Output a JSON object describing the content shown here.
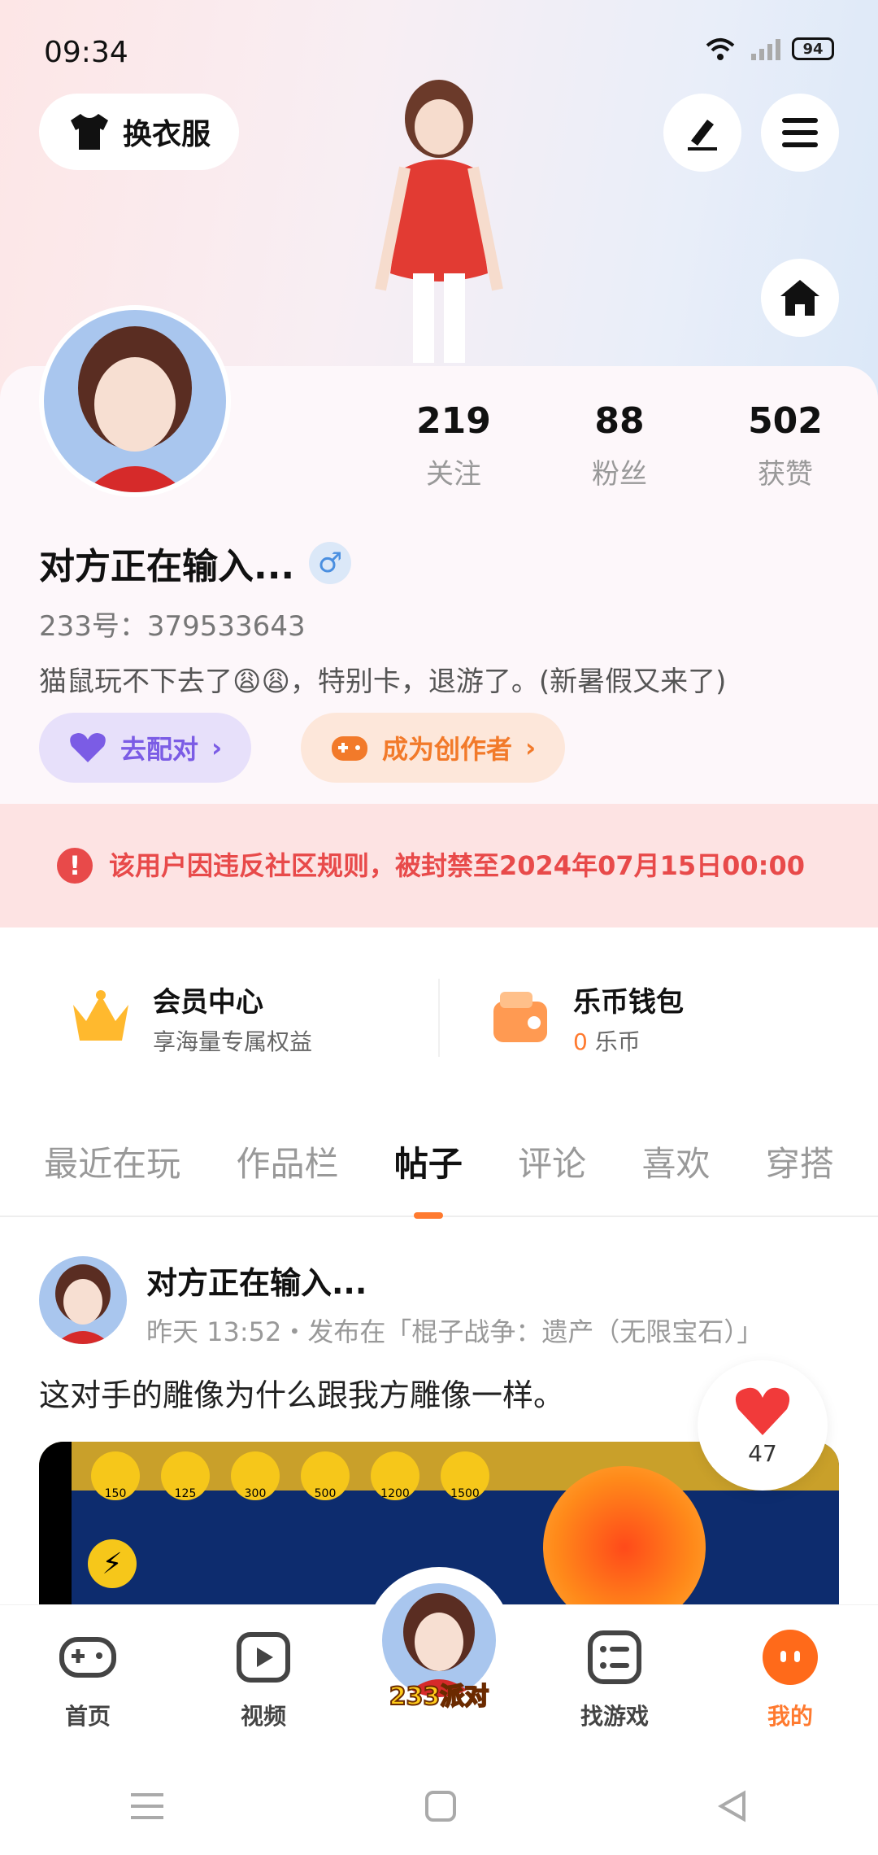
{
  "status_bar": {
    "time": "09:34",
    "battery": "94"
  },
  "header": {
    "outfit_label": "换衣服",
    "edit_icon": "pencil-icon",
    "menu_icon": "menu-icon",
    "home_icon": "home-icon"
  },
  "profile": {
    "stats": [
      {
        "value": "219",
        "label": "关注"
      },
      {
        "value": "88",
        "label": "粉丝"
      },
      {
        "value": "502",
        "label": "获赞"
      }
    ],
    "name": "对方正在输入...",
    "gender_symbol": "♂",
    "uid": "233号：379533643",
    "bio": "猫鼠玩不下去了😩😩，特别卡，退游了。(新暑假又来了)",
    "match_label": "去配对",
    "creator_label": "成为创作者"
  },
  "ban_notice": {
    "text": "该用户因违反社区规则，被封禁至2024年07月15日00:00"
  },
  "wallet": {
    "vip_title": "会员中心",
    "vip_sub": "享海量专属权益",
    "coin_title": "乐币钱包",
    "coin_amount": "0",
    "coin_unit": "乐币"
  },
  "tabs": [
    "最近在玩",
    "作品栏",
    "帖子",
    "评论",
    "喜欢",
    "穿搭"
  ],
  "active_tab": "帖子",
  "post": {
    "author": "对方正在输入...",
    "meta": "昨天 13:52・发布在「棍子战争：遗产（无限宝石）」",
    "text": "这对手的雕像为什么跟我方雕像一样。",
    "likes": "47",
    "game_costs": [
      "150",
      "125",
      "300",
      "500",
      "1200",
      "1500"
    ]
  },
  "nav": {
    "items": [
      {
        "label": "首页",
        "icon": "gamepad-icon"
      },
      {
        "label": "视频",
        "icon": "video-icon"
      },
      {
        "label": "233派对",
        "icon": "party-avatar-icon"
      },
      {
        "label": "找游戏",
        "icon": "list-icon"
      },
      {
        "label": "我的",
        "icon": "profile-icon"
      }
    ]
  },
  "colors": {
    "accent": "#ff7a2f",
    "ban": "#e84a4a",
    "match": "#7b5ce5"
  }
}
